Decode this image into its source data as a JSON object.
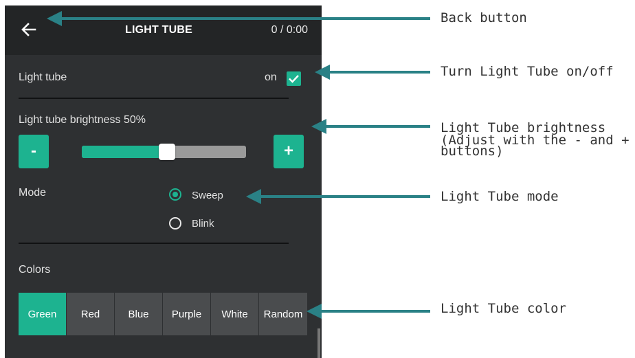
{
  "app": {
    "title": "LIGHT TUBE",
    "counter": "0 / 0:00"
  },
  "light_tube": {
    "label": "Light tube",
    "state_label": "on",
    "checked": true
  },
  "brightness": {
    "label": "Light tube brightness 50%",
    "value_percent": 50,
    "minus_label": "-",
    "plus_label": "+"
  },
  "mode": {
    "label": "Mode",
    "options": [
      {
        "label": "Sweep",
        "selected": true
      },
      {
        "label": "Blink",
        "selected": false
      }
    ]
  },
  "colors": {
    "label": "Colors",
    "options": [
      "Green",
      "Red",
      "Blue",
      "Purple",
      "White",
      "Random"
    ],
    "selected": "Green"
  },
  "annotations": {
    "back": "Back button",
    "toggle": "Turn Light Tube on/off",
    "brightness_line1": "Light Tube brightness",
    "brightness_line2": "(Adjust with the - and +",
    "brightness_line3": "buttons)",
    "mode": "Light Tube mode",
    "color": "Light Tube color"
  },
  "theme": {
    "accent": "#1db390",
    "annotation": "#2a8186",
    "background": "#2e3032",
    "topbar": "#232526"
  }
}
